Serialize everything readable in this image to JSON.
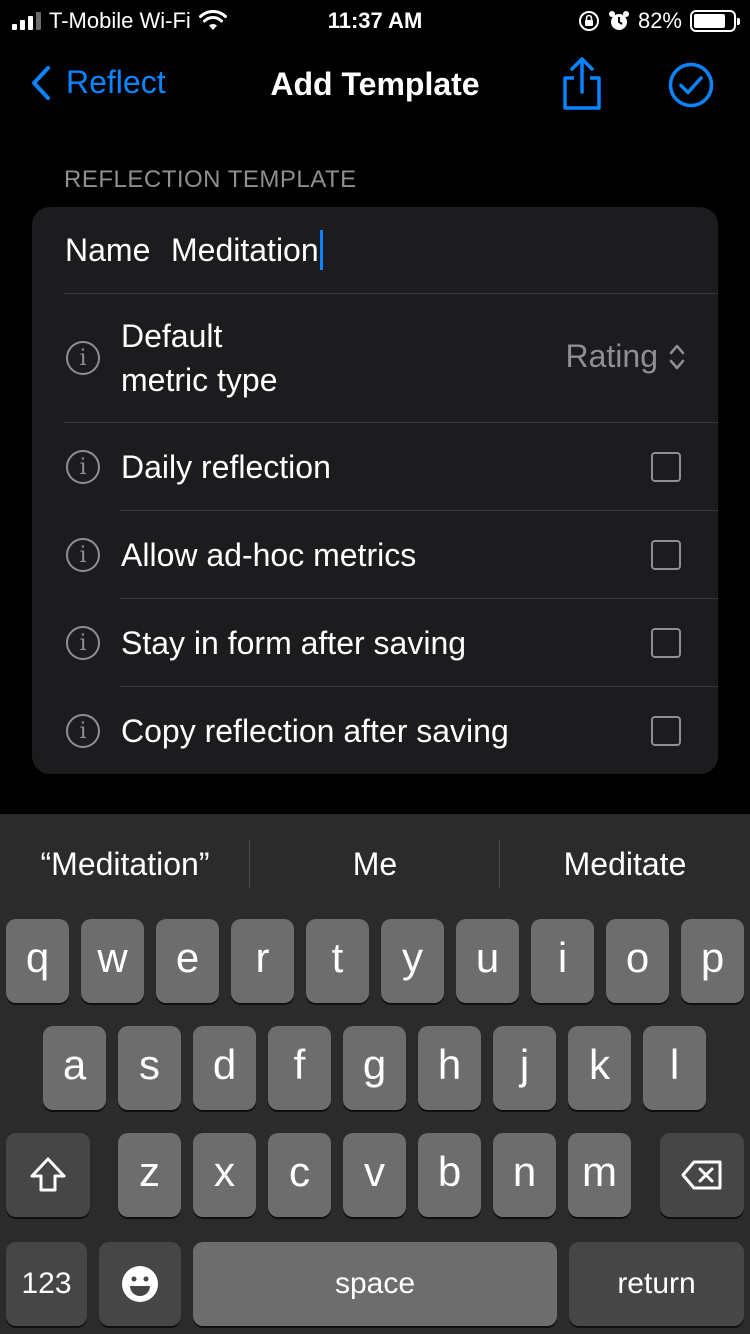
{
  "status_bar": {
    "carrier": "T-Mobile Wi-Fi",
    "time": "11:37 AM",
    "battery": "82%"
  },
  "nav": {
    "back_label": "Reflect",
    "title": "Add Template"
  },
  "section": {
    "header": "REFLECTION TEMPLATE",
    "name_label": "Name",
    "name_value": "Meditation",
    "metric": {
      "label_line1": "Default",
      "label_line2": "metric type",
      "value": "Rating"
    },
    "options": [
      {
        "label": "Daily reflection",
        "checked": false
      },
      {
        "label": "Allow ad-hoc metrics",
        "checked": false
      },
      {
        "label": "Stay in form after saving",
        "checked": false
      },
      {
        "label": "Copy reflection after saving",
        "checked": false
      }
    ]
  },
  "keyboard": {
    "suggestions": [
      "“Meditation”",
      "Me",
      "Meditate"
    ],
    "row1": [
      "q",
      "w",
      "e",
      "r",
      "t",
      "y",
      "u",
      "i",
      "o",
      "p"
    ],
    "row2": [
      "a",
      "s",
      "d",
      "f",
      "g",
      "h",
      "j",
      "k",
      "l"
    ],
    "row3": [
      "z",
      "x",
      "c",
      "v",
      "b",
      "n",
      "m"
    ],
    "numbers_key": "123",
    "space_key": "space",
    "return_key": "return"
  },
  "colors": {
    "accent": "#0a84ff",
    "background": "#000000",
    "card": "#1c1c1e",
    "key": "#6d6d6d",
    "key_dark": "#464646"
  }
}
